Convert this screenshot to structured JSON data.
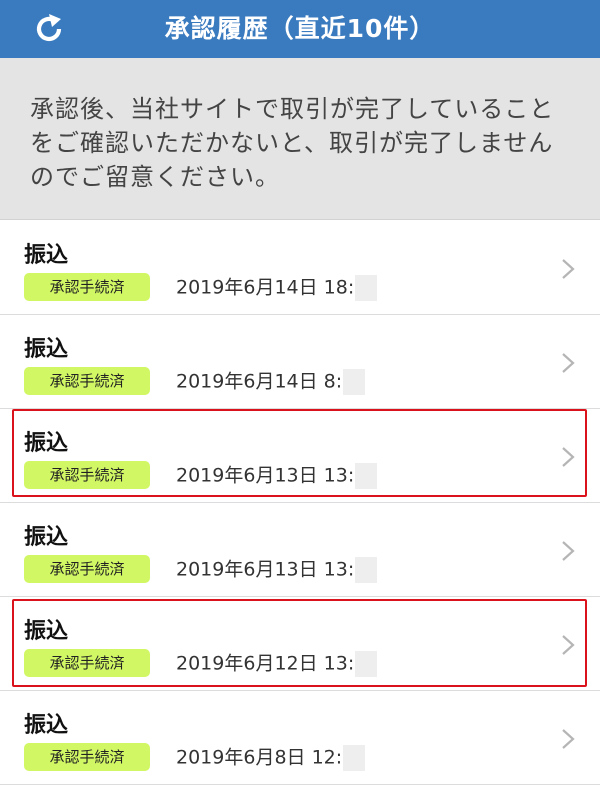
{
  "header": {
    "title": "承認履歴（直近10件）",
    "refresh_icon": "refresh-icon",
    "background": "#3a7bbf"
  },
  "notice": {
    "text": "承認後、当社サイトで取引が完了していることをご確認いただかないと、取引が完了しませんのでご留意ください。"
  },
  "colors": {
    "badge": "#d1f764",
    "highlight_border": "#d9121c"
  },
  "items": [
    {
      "title": "振込",
      "status": "承認手続済",
      "datetime": "2019年6月14日 18:",
      "highlighted": false
    },
    {
      "title": "振込",
      "status": "承認手続済",
      "datetime": "2019年6月14日 8:",
      "highlighted": false
    },
    {
      "title": "振込",
      "status": "承認手続済",
      "datetime": "2019年6月13日 13:",
      "highlighted": true
    },
    {
      "title": "振込",
      "status": "承認手続済",
      "datetime": "2019年6月13日 13:",
      "highlighted": false
    },
    {
      "title": "振込",
      "status": "承認手続済",
      "datetime": "2019年6月12日 13:",
      "highlighted": true
    },
    {
      "title": "振込",
      "status": "承認手続済",
      "datetime": "2019年6月8日 12:",
      "highlighted": false
    }
  ]
}
